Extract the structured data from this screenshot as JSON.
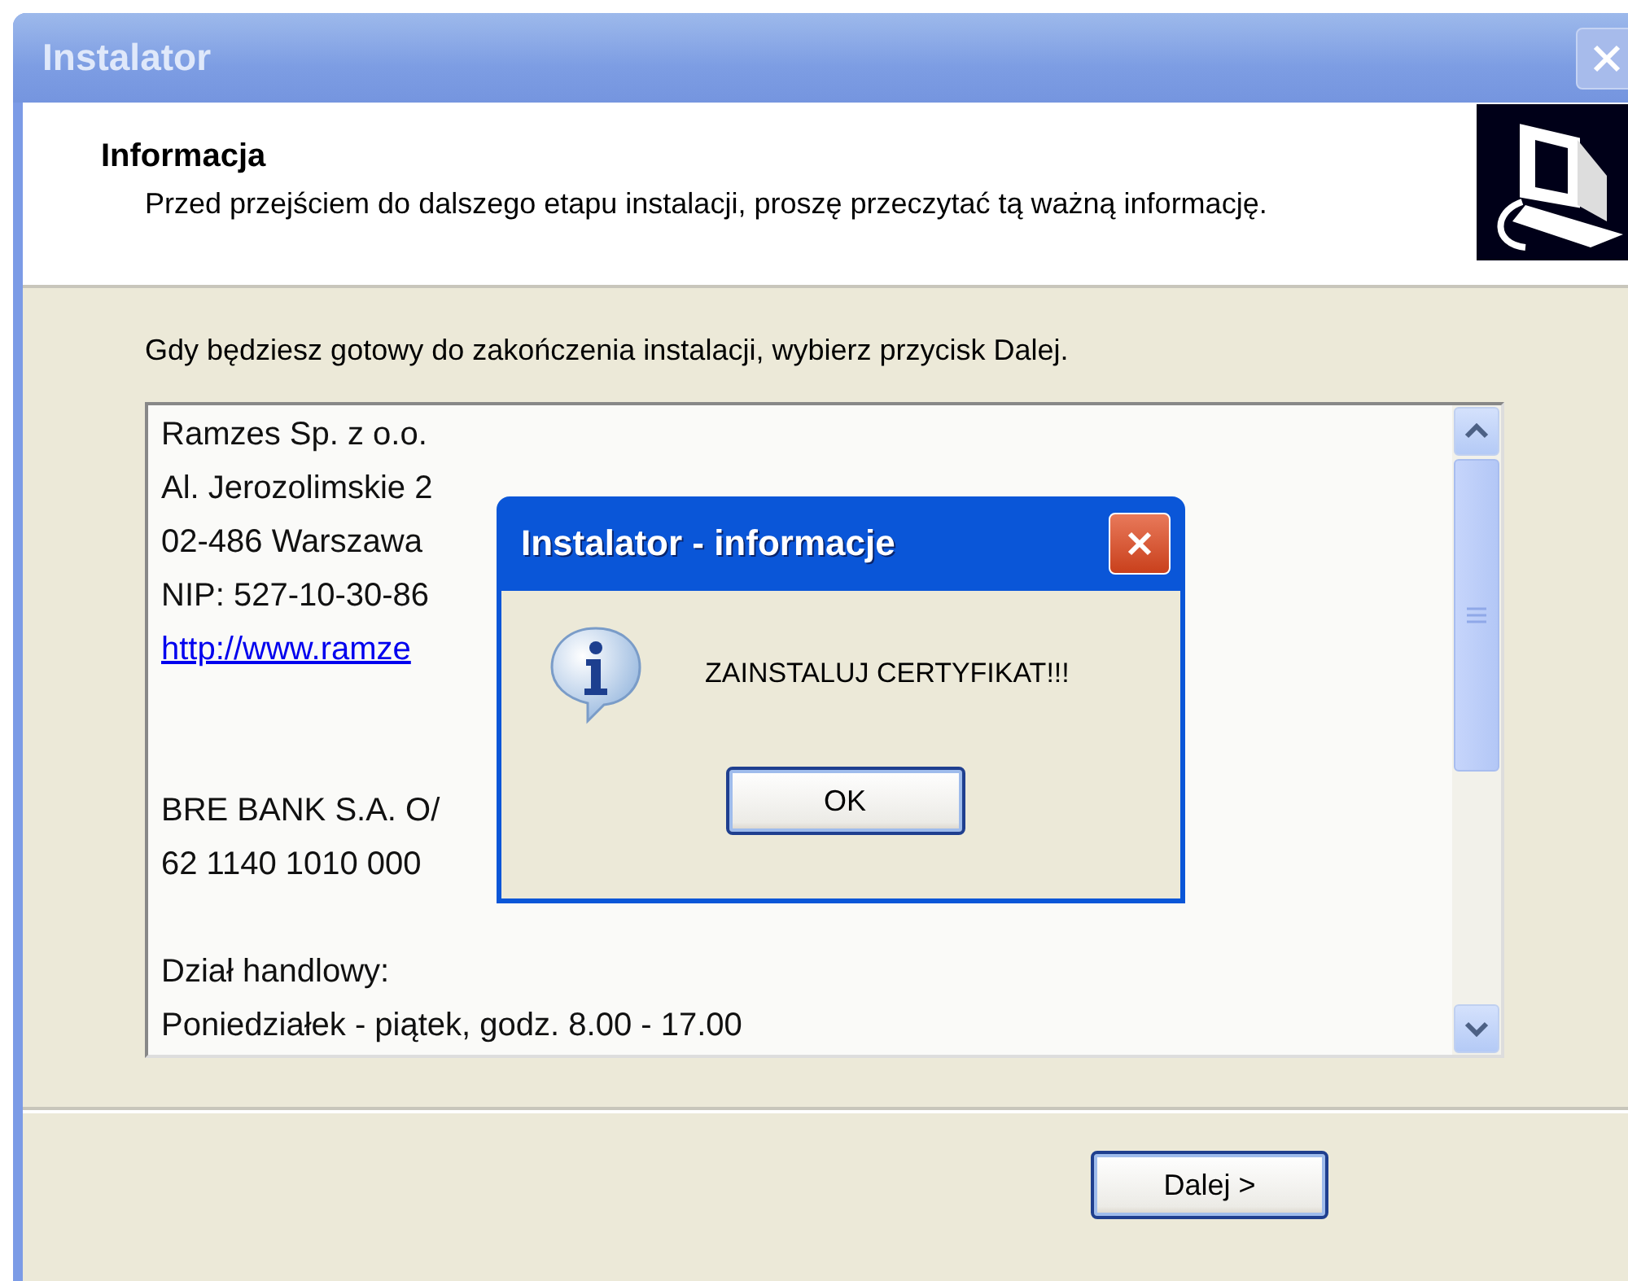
{
  "window": {
    "title": "Instalator",
    "close_disabled": true
  },
  "header": {
    "title": "Informacja",
    "subtitle": "Przed przejściem do dalszego etapu instalacji, proszę przeczytać tą ważną informację."
  },
  "instruction": "Gdy będziesz gotowy do zakończenia instalacji, wybierz przycisk Dalej.",
  "info_text": {
    "lines": [
      {
        "kind": "text",
        "text": "Ramzes Sp. z o.o."
      },
      {
        "kind": "text",
        "text": "Al. Jerozolimskie 2"
      },
      {
        "kind": "text",
        "text": "02-486 Warszawa"
      },
      {
        "kind": "text",
        "text": "NIP: 527-10-30-86"
      },
      {
        "kind": "link",
        "text": "http://www.ramze"
      },
      {
        "kind": "blank"
      },
      {
        "kind": "blank"
      },
      {
        "kind": "text",
        "text": "BRE BANK S.A. O/"
      },
      {
        "kind": "text",
        "text": "62 1140 1010 000"
      },
      {
        "kind": "blank"
      },
      {
        "kind": "text",
        "text": "Dział handlowy:"
      },
      {
        "kind": "text",
        "text": "Poniedziałek - piątek, godz. 8.00 - 17.00"
      }
    ]
  },
  "buttons": [
    {
      "label": "Dalej >"
    }
  ],
  "dialog": {
    "title": "Instalator - informacje",
    "message": "ZAINSTALUJ CERTYFIKAT!!!",
    "button": "OK"
  }
}
